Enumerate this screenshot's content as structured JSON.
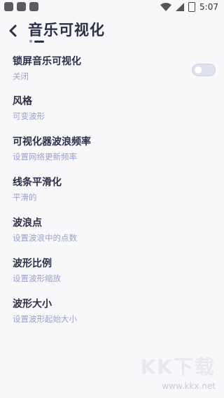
{
  "status_bar": {
    "time": "5:07"
  },
  "header": {
    "title": "音乐可视化"
  },
  "settings": [
    {
      "title": "锁屏音乐可视化",
      "subtitle": "关闭"
    },
    {
      "title": "风格",
      "subtitle": "可变波形"
    },
    {
      "title": "可视化器波浪频率",
      "subtitle": "设置网络更新频率"
    },
    {
      "title": "线条平滑化",
      "subtitle": "平滑的"
    },
    {
      "title": "波浪点",
      "subtitle": "设置波浪中的点数"
    },
    {
      "title": "波形比例",
      "subtitle": "设置波形缩放"
    },
    {
      "title": "波形大小",
      "subtitle": "设置波形起始大小"
    }
  ],
  "toggle_state": "off",
  "watermark": {
    "logo": "KK下载",
    "url": "www.kkx.net"
  },
  "colors": {
    "accent": "#2b2f48",
    "subtitle": "#9aa1c9",
    "background": "#f8f8fa"
  }
}
